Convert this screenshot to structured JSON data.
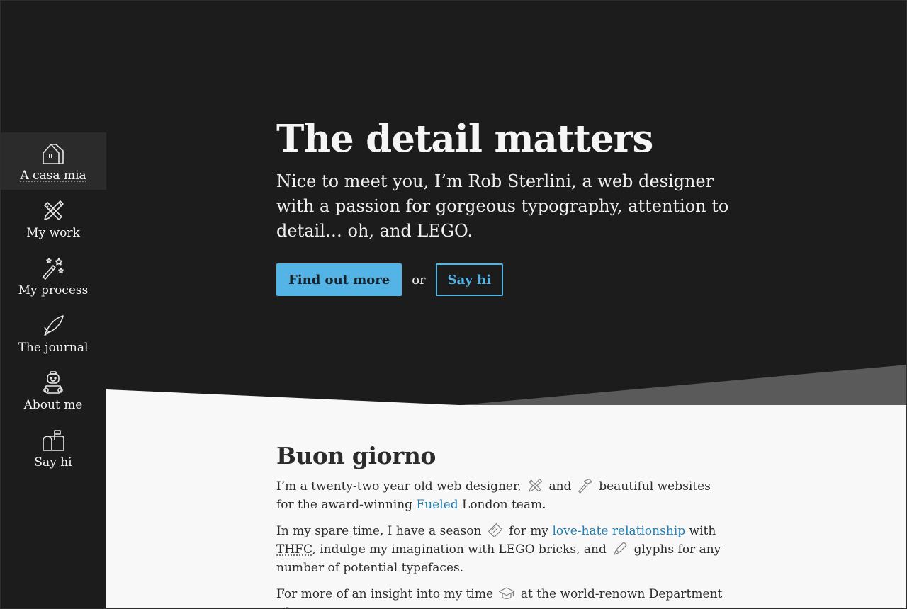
{
  "nav": {
    "items": [
      {
        "label": "A casa mia",
        "icon": "house-icon",
        "active": true
      },
      {
        "label": "My work",
        "icon": "pencil-ruler-icon"
      },
      {
        "label": "My process",
        "icon": "magic-wand-icon"
      },
      {
        "label": "The journal",
        "icon": "quill-icon"
      },
      {
        "label": "About me",
        "icon": "minifig-icon"
      },
      {
        "label": "Say hi",
        "icon": "mailbox-icon"
      }
    ]
  },
  "hero": {
    "title": "The detail matters",
    "intro": "Nice to meet you, I’m Rob Sterlini, a web designer with a passion for gorgeous typography, attention to detail… oh, and LEGO.",
    "cta_primary": "Find out more",
    "or": "or",
    "cta_secondary": "Say hi"
  },
  "content": {
    "title": "Buon giorno",
    "p1": {
      "a": "I’m a twenty-two year old web designer,",
      "b": "and",
      "c": "beautiful websites for the award-winning",
      "link": "Fueled",
      "d": "London team."
    },
    "p2": {
      "a": "In my spare time, I have a season",
      "b": "for my",
      "link": "love-hate relationship",
      "c": "with",
      "abbr": "THFC",
      "d": ", indulge my imagination with LEGO bricks, and",
      "e": "glyphs for any number of potential typefaces."
    },
    "p3": {
      "a": "For more of an insight into my time",
      "b": "at the world-renown Department of"
    }
  },
  "colors": {
    "background": "#1c1c1d",
    "accent": "#55b4e6",
    "link": "#1f7fb5",
    "content_bg": "#f8f8f8"
  }
}
